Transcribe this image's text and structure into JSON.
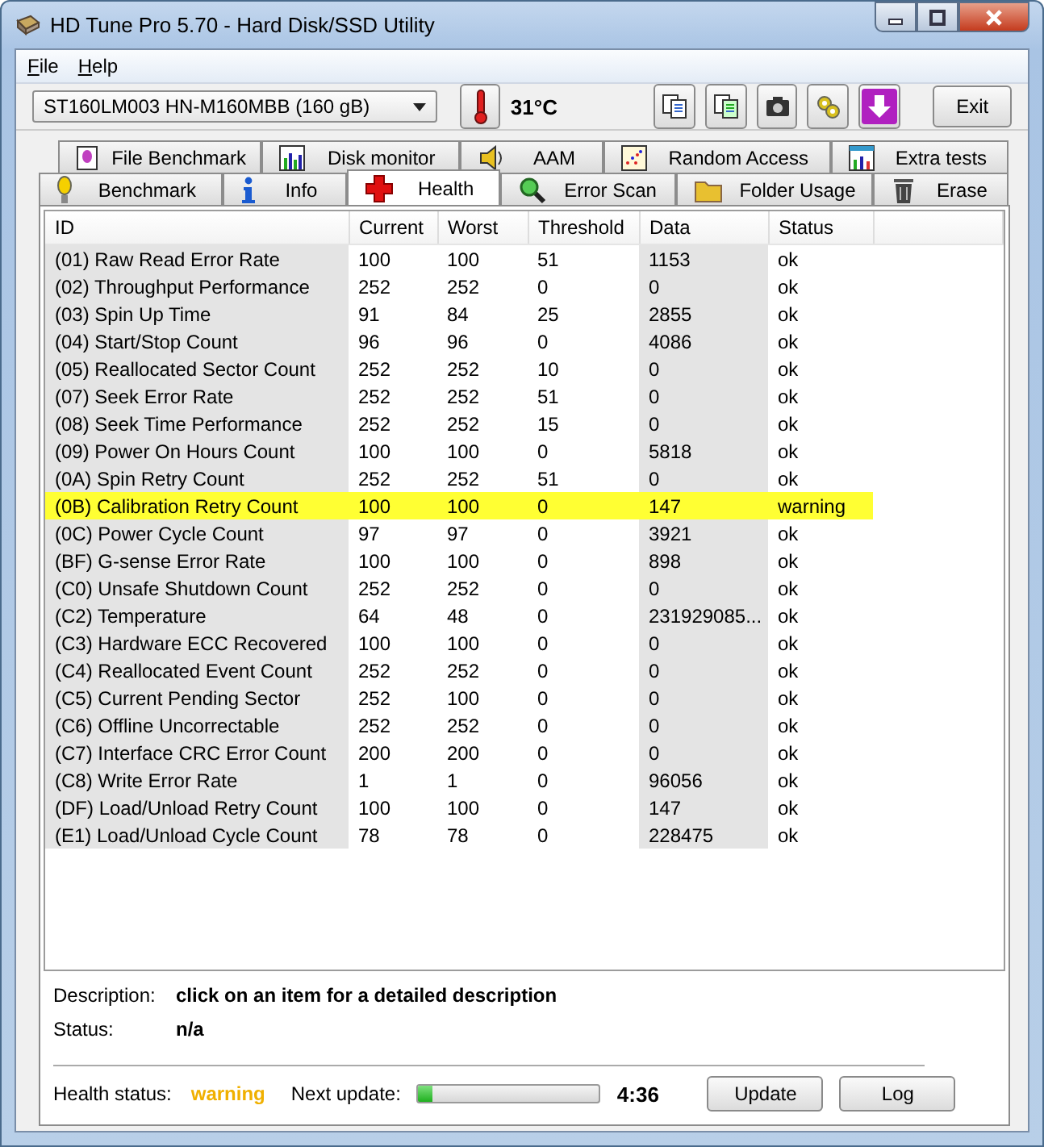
{
  "window": {
    "title": "HD Tune Pro 5.70 - Hard Disk/SSD Utility"
  },
  "menu": [
    "File",
    "Help"
  ],
  "toolbar": {
    "drive": "ST160LM003 HN-M160MBB (160 gB)",
    "temperature": "31°C",
    "exit_button": "Exit"
  },
  "tabs_top": [
    {
      "label": "File Benchmark",
      "selected": false
    },
    {
      "label": "Disk monitor",
      "selected": false
    },
    {
      "label": "AAM",
      "selected": false
    },
    {
      "label": "Random Access",
      "selected": false
    },
    {
      "label": "Extra tests",
      "selected": false
    }
  ],
  "tabs_bottom": [
    {
      "label": "Benchmark",
      "selected": false
    },
    {
      "label": "Info",
      "selected": false
    },
    {
      "label": "Health",
      "selected": true
    },
    {
      "label": "Error Scan",
      "selected": false
    },
    {
      "label": "Folder Usage",
      "selected": false
    },
    {
      "label": "Erase",
      "selected": false
    }
  ],
  "table": {
    "columns": [
      "ID",
      "Current",
      "Worst",
      "Threshold",
      "Data",
      "Status"
    ],
    "rows": [
      {
        "cells": [
          "(01) Raw Read Error Rate",
          "100",
          "100",
          "51",
          "1153",
          "ok"
        ],
        "warning": false
      },
      {
        "cells": [
          "(02) Throughput Performance",
          "252",
          "252",
          "0",
          "0",
          "ok"
        ],
        "warning": false
      },
      {
        "cells": [
          "(03) Spin Up Time",
          "91",
          "84",
          "25",
          "2855",
          "ok"
        ],
        "warning": false
      },
      {
        "cells": [
          "(04) Start/Stop Count",
          "96",
          "96",
          "0",
          "4086",
          "ok"
        ],
        "warning": false
      },
      {
        "cells": [
          "(05) Reallocated Sector Count",
          "252",
          "252",
          "10",
          "0",
          "ok"
        ],
        "warning": false
      },
      {
        "cells": [
          "(07) Seek Error Rate",
          "252",
          "252",
          "51",
          "0",
          "ok"
        ],
        "warning": false
      },
      {
        "cells": [
          "(08) Seek Time Performance",
          "252",
          "252",
          "15",
          "0",
          "ok"
        ],
        "warning": false
      },
      {
        "cells": [
          "(09) Power On Hours Count",
          "100",
          "100",
          "0",
          "5818",
          "ok"
        ],
        "warning": false
      },
      {
        "cells": [
          "(0A) Spin Retry Count",
          "252",
          "252",
          "51",
          "0",
          "ok"
        ],
        "warning": false
      },
      {
        "cells": [
          "(0B) Calibration Retry Count",
          "100",
          "100",
          "0",
          "147",
          "warning"
        ],
        "warning": true
      },
      {
        "cells": [
          "(0C) Power Cycle Count",
          "97",
          "97",
          "0",
          "3921",
          "ok"
        ],
        "warning": false
      },
      {
        "cells": [
          "(BF) G-sense Error Rate",
          "100",
          "100",
          "0",
          "898",
          "ok"
        ],
        "warning": false
      },
      {
        "cells": [
          "(C0) Unsafe Shutdown Count",
          "252",
          "252",
          "0",
          "0",
          "ok"
        ],
        "warning": false
      },
      {
        "cells": [
          "(C2) Temperature",
          "64",
          "48",
          "0",
          "231929085...",
          "ok"
        ],
        "warning": false
      },
      {
        "cells": [
          "(C3) Hardware ECC Recovered",
          "100",
          "100",
          "0",
          "0",
          "ok"
        ],
        "warning": false
      },
      {
        "cells": [
          "(C4) Reallocated Event Count",
          "252",
          "252",
          "0",
          "0",
          "ok"
        ],
        "warning": false
      },
      {
        "cells": [
          "(C5) Current Pending Sector",
          "252",
          "100",
          "0",
          "0",
          "ok"
        ],
        "warning": false
      },
      {
        "cells": [
          "(C6) Offline Uncorrectable",
          "252",
          "252",
          "0",
          "0",
          "ok"
        ],
        "warning": false
      },
      {
        "cells": [
          "(C7) Interface CRC Error Count",
          "200",
          "200",
          "0",
          "0",
          "ok"
        ],
        "warning": false
      },
      {
        "cells": [
          "(C8) Write Error Rate",
          "1",
          "1",
          "0",
          "96056",
          "ok"
        ],
        "warning": false
      },
      {
        "cells": [
          "(DF) Load/Unload Retry Count",
          "100",
          "100",
          "0",
          "147",
          "ok"
        ],
        "warning": false
      },
      {
        "cells": [
          "(E1) Load/Unload Cycle Count",
          "78",
          "78",
          "0",
          "228475",
          "ok"
        ],
        "warning": false
      }
    ]
  },
  "description": {
    "label": "Description:",
    "value": "click on an item for a detailed description"
  },
  "status": {
    "label": "Status:",
    "value": "n/a"
  },
  "footer": {
    "health_label": "Health status:",
    "health_value": "warning",
    "next_label": "Next update:",
    "level": 0.08,
    "countdown": "4:36",
    "buttons": [
      "Update",
      "Log"
    ]
  }
}
